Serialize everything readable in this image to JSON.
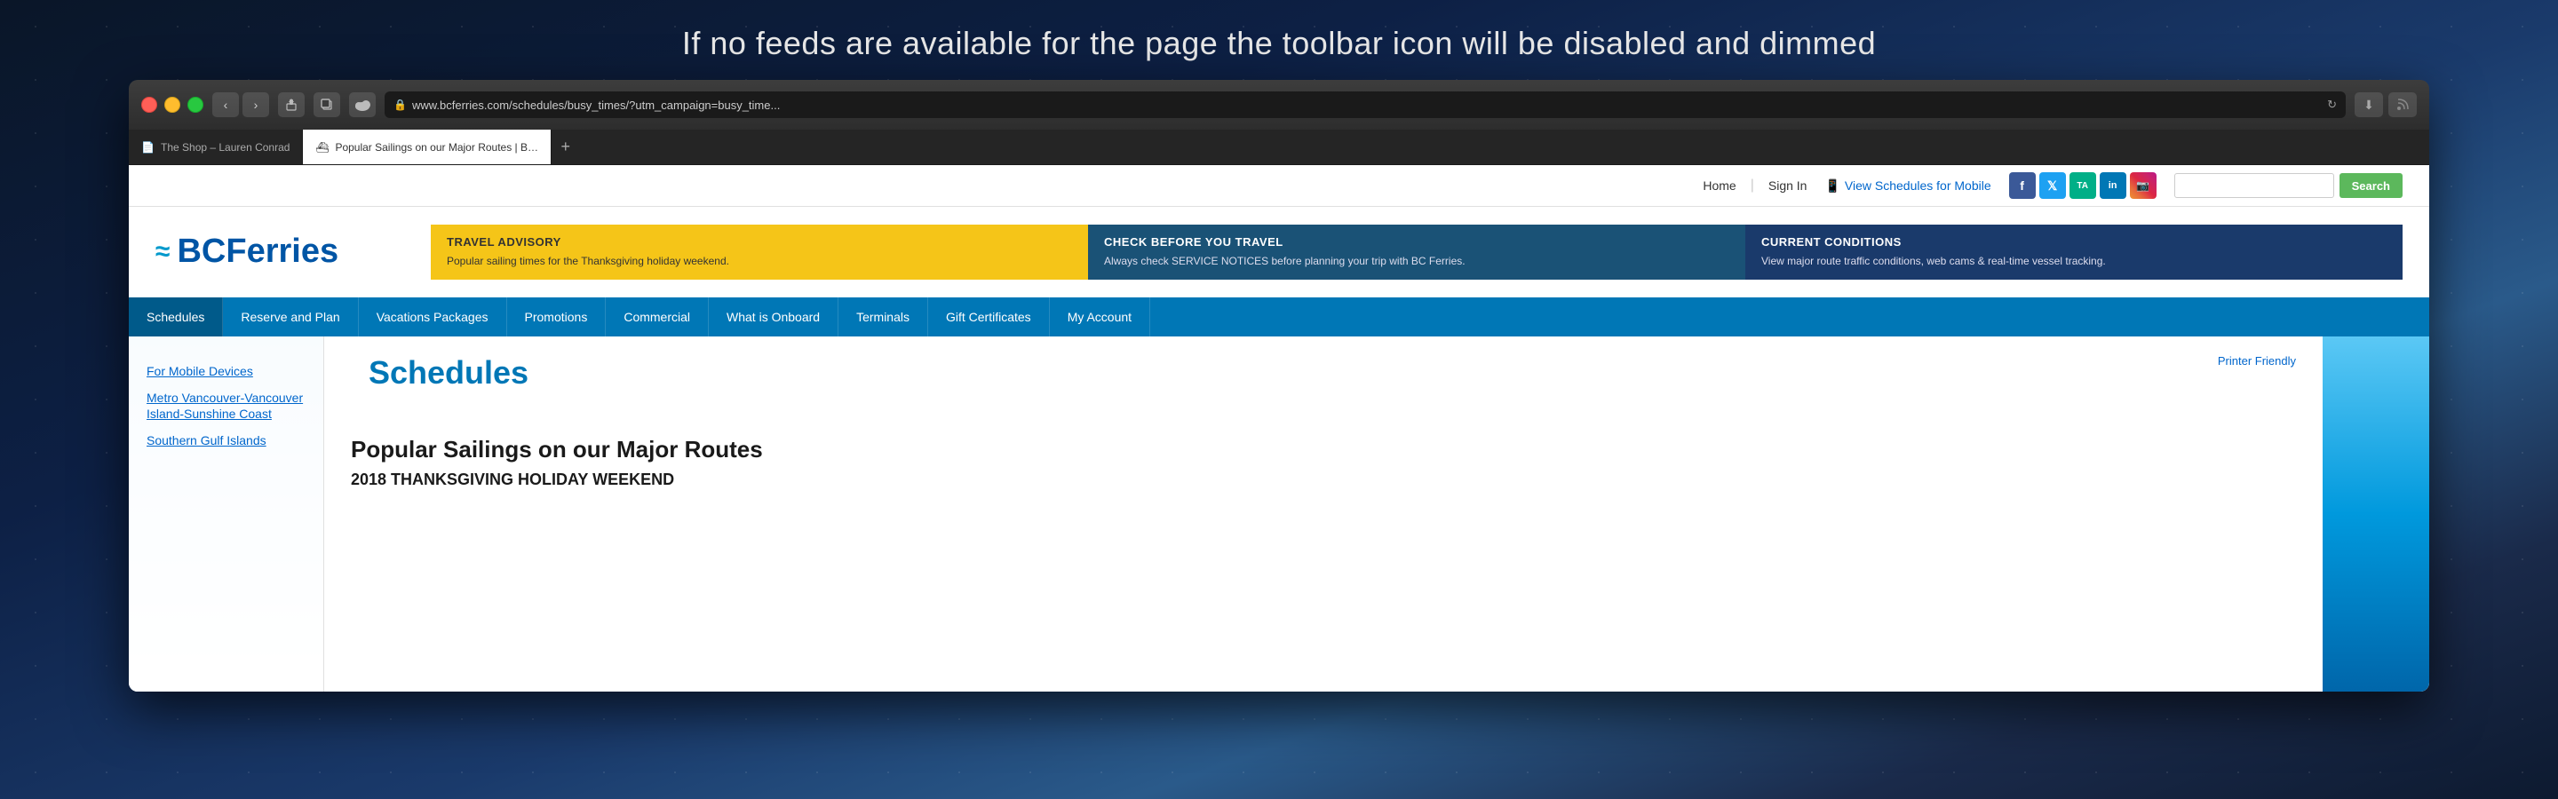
{
  "top_message": "If no feeds are available for the page the toolbar icon will be disabled and dimmed",
  "browser": {
    "url": "www.bcferries.com/schedules/busy_times/?utm_campaign=busy_time...",
    "tabs": [
      {
        "title": "The Shop – Lauren Conrad",
        "active": false,
        "icon": "📄"
      },
      {
        "title": "Popular Sailings on our Major Routes | BC Ferries - British Columbia Ferry Services Inc.",
        "active": true,
        "icon": "⛴"
      }
    ],
    "tab_add_label": "+"
  },
  "site": {
    "topbar": {
      "home_label": "Home",
      "signin_label": "Sign In",
      "mobile_label": "View Schedules for Mobile",
      "search_placeholder": "",
      "search_btn": "Search"
    },
    "logo": {
      "text": "BCFerries",
      "waves": "≈"
    },
    "advisory": [
      {
        "type": "yellow",
        "title": "TRAVEL ADVISORY",
        "text": "Popular sailing times for the Thanksgiving holiday weekend."
      },
      {
        "type": "blue",
        "title": "CHECK BEFORE YOU TRAVEL",
        "text": "Always check SERVICE NOTICES before planning your trip with BC Ferries."
      },
      {
        "type": "dark-blue",
        "title": "CURRENT CONDITIONS",
        "text": "View major route traffic conditions, web cams & real-time vessel tracking."
      }
    ],
    "nav": [
      {
        "label": "Schedules",
        "active": true
      },
      {
        "label": "Reserve and Plan",
        "active": false
      },
      {
        "label": "Vacations Packages",
        "active": false
      },
      {
        "label": "Promotions",
        "active": false
      },
      {
        "label": "Commercial",
        "active": false
      },
      {
        "label": "What is Onboard",
        "active": false
      },
      {
        "label": "Terminals",
        "active": false
      },
      {
        "label": "Gift Certificates",
        "active": false
      },
      {
        "label": "My Account",
        "active": false
      }
    ],
    "page": {
      "title": "Schedules",
      "printer_friendly": "Printer Friendly",
      "sidebar_links": [
        "For Mobile Devices",
        "Metro Vancouver-Vancouver Island-Sunshine Coast",
        "Southern Gulf Islands"
      ],
      "content_heading": "Popular Sailings on our Major Routes",
      "content_subheading": "2018 THANKSGIVING HOLIDAY WEEKEND"
    }
  }
}
